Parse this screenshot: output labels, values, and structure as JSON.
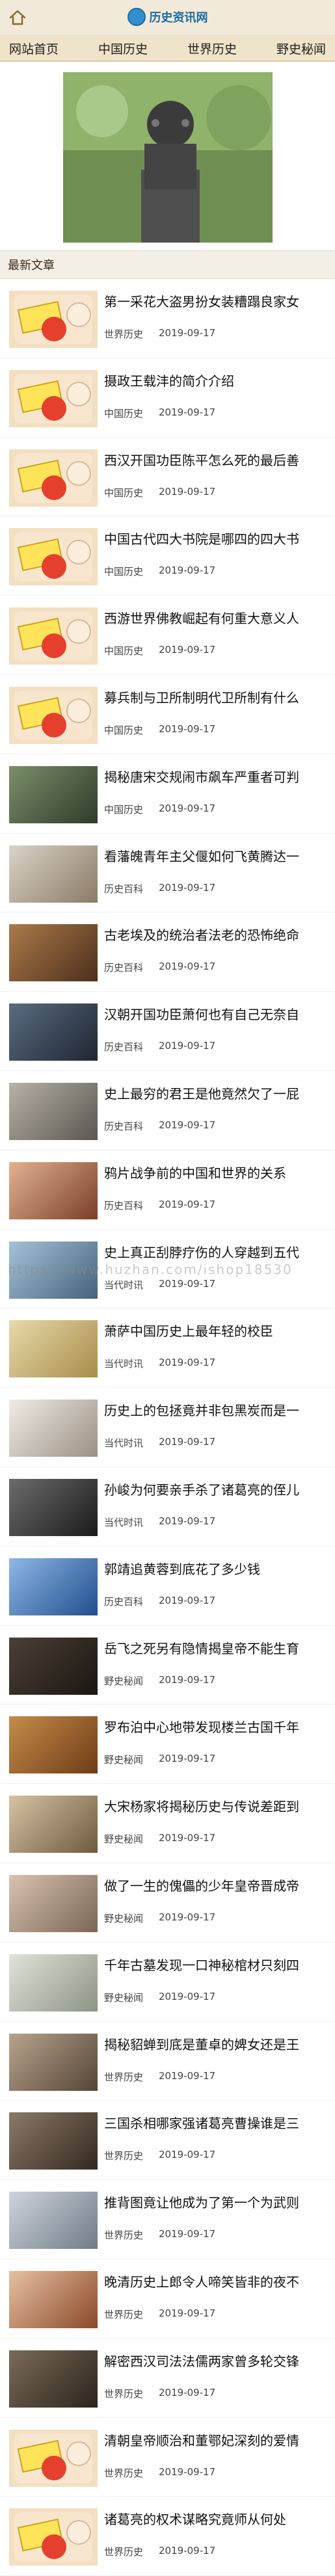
{
  "header": {
    "site_name": "历史资讯网"
  },
  "nav": [
    "网站首页",
    "中国历史",
    "世界历史",
    "野史秘闻"
  ],
  "section": {
    "title": "最新文章"
  },
  "watermark": "https://www.huzhan.com/ishop18530",
  "articles": [
    {
      "title": "第一采花大盗男扮女装糟蹋良家女",
      "category": "世界历史",
      "date": "2019-09-17",
      "thumb": "default"
    },
    {
      "title": "摄政王载沣的简介介绍",
      "category": "中国历史",
      "date": "2019-09-17",
      "thumb": "default"
    },
    {
      "title": "西汉开国功臣陈平怎么死的最后善",
      "category": "中国历史",
      "date": "2019-09-17",
      "thumb": "default"
    },
    {
      "title": "中国古代四大书院是哪四的四大书",
      "category": "中国历史",
      "date": "2019-09-17",
      "thumb": "default"
    },
    {
      "title": "西游世界佛教崛起有何重大意义人",
      "category": "中国历史",
      "date": "2019-09-17",
      "thumb": "default"
    },
    {
      "title": "募兵制与卫所制明代卫所制有什么",
      "category": "中国历史",
      "date": "2019-09-17",
      "thumb": "default"
    },
    {
      "title": "揭秘唐宋交规闹市飙车严重者可判",
      "category": "中国历史",
      "date": "2019-09-17",
      "thumb": "photo1"
    },
    {
      "title": "看藩魄青年主父偃如何飞黄腾达一",
      "category": "历史百科",
      "date": "2019-09-17",
      "thumb": "photo2"
    },
    {
      "title": "古老埃及的统治者法老的恐怖绝命",
      "category": "历史百科",
      "date": "2019-09-17",
      "thumb": "photo3"
    },
    {
      "title": "汉朝开国功臣萧何也有自己无奈自",
      "category": "历史百科",
      "date": "2019-09-17",
      "thumb": "photo4"
    },
    {
      "title": "史上最穷的君王是他竟然欠了一屁",
      "category": "历史百科",
      "date": "2019-09-17",
      "thumb": "photo5"
    },
    {
      "title": "鸦片战争前的中国和世界的关系",
      "category": "历史百科",
      "date": "2019-09-17",
      "thumb": "photo6"
    },
    {
      "title": "史上真正刮脖疗伤的人穿越到五代",
      "category": "当代时讯",
      "date": "2019-09-17",
      "thumb": "photo7"
    },
    {
      "title": "萧萨中国历史上最年轻的校臣",
      "category": "当代时讯",
      "date": "2019-09-17",
      "thumb": "photo8"
    },
    {
      "title": "历史上的包拯竟并非包黑炭而是一",
      "category": "当代时讯",
      "date": "2019-09-17",
      "thumb": "photo9"
    },
    {
      "title": "孙峻为何要亲手杀了诸葛亮的侄儿",
      "category": "当代时讯",
      "date": "2019-09-17",
      "thumb": "photo10"
    },
    {
      "title": "郭靖追黄蓉到底花了多少钱",
      "category": "历史百科",
      "date": "2019-09-17",
      "thumb": "photo11"
    },
    {
      "title": "岳飞之死另有隐情揭皇帝不能生育",
      "category": "野史秘闻",
      "date": "2019-09-17",
      "thumb": "photo12"
    },
    {
      "title": "罗布泊中心地带发现楼兰古国千年",
      "category": "野史秘闻",
      "date": "2019-09-17",
      "thumb": "photo13"
    },
    {
      "title": "大宋杨家将揭秘历史与传说差距到",
      "category": "野史秘闻",
      "date": "2019-09-17",
      "thumb": "photo14"
    },
    {
      "title": "做了一生的傀儡的少年皇帝晋成帝",
      "category": "野史秘闻",
      "date": "2019-09-17",
      "thumb": "photo15"
    },
    {
      "title": "千年古墓发现一口神秘棺材只刻四",
      "category": "野史秘闻",
      "date": "2019-09-17",
      "thumb": "photo16"
    },
    {
      "title": "揭秘貂蝉到底是董卓的婢女还是王",
      "category": "世界历史",
      "date": "2019-09-17",
      "thumb": "photo17"
    },
    {
      "title": "三国杀相哪家强诸葛亮曹操谁是三",
      "category": "世界历史",
      "date": "2019-09-17",
      "thumb": "photo18"
    },
    {
      "title": "推背图竟让他成为了第一个为武则",
      "category": "世界历史",
      "date": "2019-09-17",
      "thumb": "photo19"
    },
    {
      "title": "晚清历史上郎令人啼笑皆非的夜不",
      "category": "世界历史",
      "date": "2019-09-17",
      "thumb": "photo20"
    },
    {
      "title": "解密西汉司法法儒两家曾多轮交锋",
      "category": "世界历史",
      "date": "2019-09-17",
      "thumb": "photo21"
    },
    {
      "title": "清朝皇帝顺治和董鄂妃深刻的爱情",
      "category": "世界历史",
      "date": "2019-09-17",
      "thumb": "default"
    },
    {
      "title": "诸葛亮的权术谋略究竟师从何处",
      "category": "世界历史",
      "date": "2019-09-17",
      "thumb": "default"
    }
  ]
}
